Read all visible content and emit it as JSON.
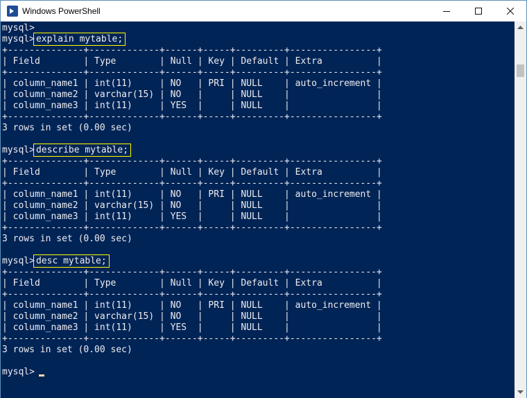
{
  "window": {
    "title": "Windows PowerShell",
    "controls": {
      "minimize": "minimize",
      "maximize": "maximize",
      "close": "close"
    }
  },
  "console": {
    "line0": {
      "text": "mysql>"
    },
    "line1": {
      "prompt": "mysql>",
      "command": "explain mytable;"
    },
    "line2": {
      "text": "+--------------+-------------+------+-----+---------+----------------+"
    },
    "line3": {
      "text": "| Field        | Type        | Null | Key | Default | Extra          |"
    },
    "line4": {
      "text": "+--------------+-------------+------+-----+---------+----------------+"
    },
    "line5": {
      "text": "| column_name1 | int(11)     | NO   | PRI | NULL    | auto_increment |"
    },
    "line6": {
      "text": "| column_name2 | varchar(15) | NO   |     | NULL    |                |"
    },
    "line7": {
      "text": "| column_name3 | int(11)     | YES  |     | NULL    |                |"
    },
    "line8": {
      "text": "+--------------+-------------+------+-----+---------+----------------+"
    },
    "line9": {
      "text": "3 rows in set (0.00 sec)"
    },
    "line10": {
      "text": ""
    },
    "line11": {
      "prompt": "mysql>",
      "command": "describe mytable;"
    },
    "line12": {
      "text": "+--------------+-------------+------+-----+---------+----------------+"
    },
    "line13": {
      "text": "| Field        | Type        | Null | Key | Default | Extra          |"
    },
    "line14": {
      "text": "+--------------+-------------+------+-----+---------+----------------+"
    },
    "line15": {
      "text": "| column_name1 | int(11)     | NO   | PRI | NULL    | auto_increment |"
    },
    "line16": {
      "text": "| column_name2 | varchar(15) | NO   |     | NULL    |                |"
    },
    "line17": {
      "text": "| column_name3 | int(11)     | YES  |     | NULL    |                |"
    },
    "line18": {
      "text": "+--------------+-------------+------+-----+---------+----------------+"
    },
    "line19": {
      "text": "3 rows in set (0.00 sec)"
    },
    "line20": {
      "text": ""
    },
    "line21": {
      "prompt": "mysql>",
      "command": "desc mytable;"
    },
    "line22": {
      "text": "+--------------+-------------+------+-----+---------+----------------+"
    },
    "line23": {
      "text": "| Field        | Type        | Null | Key | Default | Extra          |"
    },
    "line24": {
      "text": "+--------------+-------------+------+-----+---------+----------------+"
    },
    "line25": {
      "text": "| column_name1 | int(11)     | NO   | PRI | NULL    | auto_increment |"
    },
    "line26": {
      "text": "| column_name2 | varchar(15) | NO   |     | NULL    |                |"
    },
    "line27": {
      "text": "| column_name3 | int(11)     | YES  |     | NULL    |                |"
    },
    "line28": {
      "text": "+--------------+-------------+------+-----+---------+----------------+"
    },
    "line29": {
      "text": "3 rows in set (0.00 sec)"
    },
    "line30": {
      "text": ""
    },
    "line31": {
      "prompt": "mysql>"
    }
  },
  "colors": {
    "console_bg": "#012456",
    "console_fg": "#eeedf0",
    "highlight_box": "#ffff00",
    "cursor": "#fedba9"
  }
}
